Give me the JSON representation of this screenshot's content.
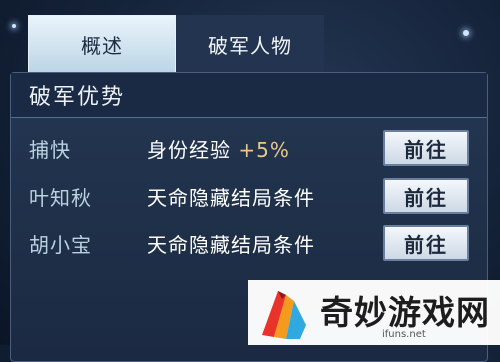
{
  "tabs": [
    {
      "label": "概述",
      "active": true
    },
    {
      "label": "破军人物",
      "active": false
    }
  ],
  "panel": {
    "title": "破军优势",
    "rows": [
      {
        "name": "捕快",
        "condition": "身份经验",
        "bonus": "+5%",
        "button": "前往"
      },
      {
        "name": "叶知秋",
        "condition": "天命隐藏结局条件",
        "bonus": "",
        "button": "前往"
      },
      {
        "name": "胡小宝",
        "condition": "天命隐藏结局条件",
        "bonus": "",
        "button": "前往"
      }
    ]
  },
  "watermark": {
    "text": "奇妙游戏网",
    "url": "ifuns.net"
  },
  "colors": {
    "accent_bonus": "#e8c88a",
    "tab_active_bg": "#d6e6f1",
    "panel_bg": "#1f2f48",
    "name_text": "#b8d2e0"
  }
}
